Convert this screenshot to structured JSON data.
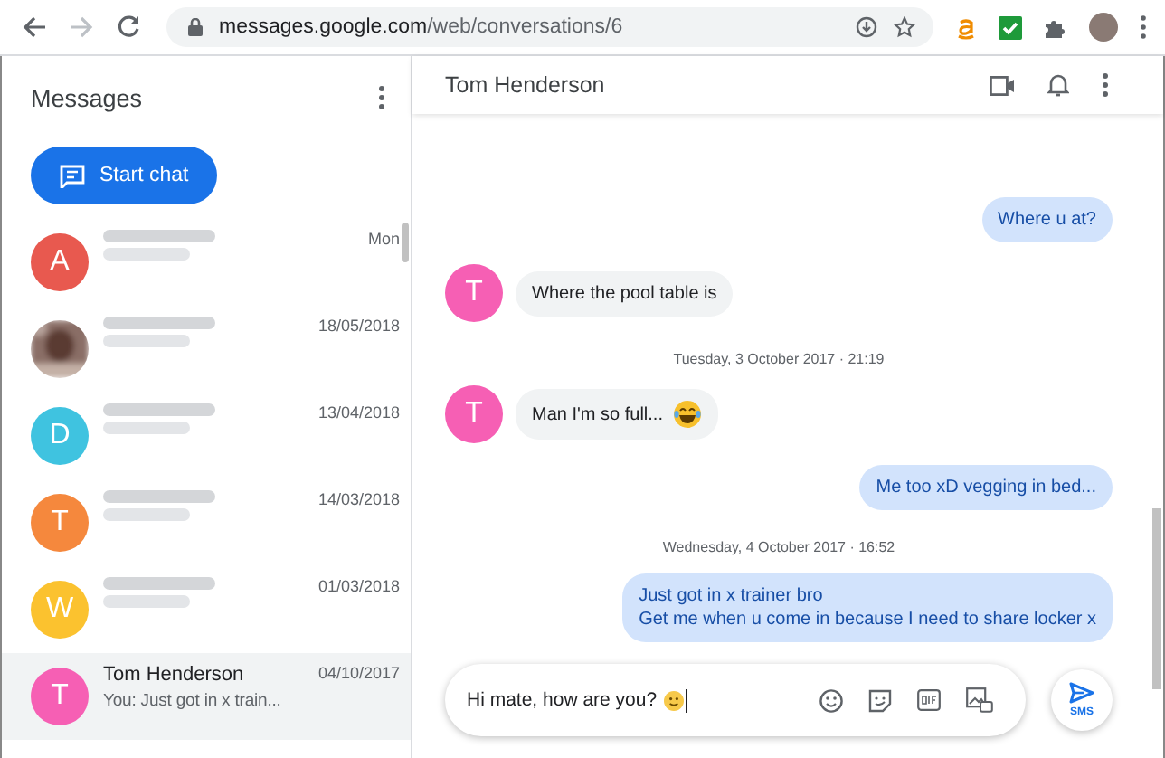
{
  "browser": {
    "url_host": "messages.google.com",
    "url_path": "/web/conversations/6"
  },
  "sidebar": {
    "title": "Messages",
    "start_chat": "Start chat",
    "conversations": [
      {
        "kind": "letter",
        "initial": "A",
        "color": "#e8594f",
        "date": "Mon",
        "blurred": true,
        "selected": false
      },
      {
        "date": "18/05/2018",
        "blurred": true,
        "selected": false
      },
      {
        "kind": "letter",
        "initial": "D",
        "color": "#3fc3e0",
        "date": "13/04/2018",
        "blurred": true,
        "selected": false
      },
      {
        "kind": "letter",
        "initial": "T",
        "color": "#f5883d",
        "date": "14/03/2018",
        "blurred": true,
        "selected": false
      },
      {
        "kind": "letter",
        "initial": "W",
        "color": "#fbc22f",
        "date": "01/03/2018",
        "blurred": true,
        "selected": false
      },
      {
        "kind": "letter",
        "initial": "T",
        "color": "#f65fb4",
        "name": "Tom Henderson",
        "snippet": "You: Just got in x train...",
        "date": "04/10/2017",
        "blurred": false,
        "selected": true
      }
    ]
  },
  "conversation": {
    "title": "Tom Henderson",
    "messages": [
      {
        "kind": "outgoing",
        "text": "Where u at?"
      },
      {
        "kind": "incoming",
        "initial": "T",
        "color": "#f65fb4",
        "text": "Where the pool table is"
      },
      {
        "kind": "date",
        "text": "Tuesday, 3 October 2017 · 21:19"
      },
      {
        "kind": "incoming-laugh",
        "initial": "T",
        "color": "#f65fb4",
        "text": "Man I'm so full..."
      },
      {
        "kind": "outgoing",
        "text": "Me too xD vegging in bed..."
      },
      {
        "kind": "date",
        "text": "Wednesday, 4 October 2017 · 16:52"
      },
      {
        "kind": "outgoing",
        "text": "Just got in x trainer bro\nGet me when u come in because I need to share locker x"
      }
    ],
    "composer": {
      "kind": "smile",
      "value": "Hi mate, how are you?",
      "send_label": "SMS"
    }
  }
}
